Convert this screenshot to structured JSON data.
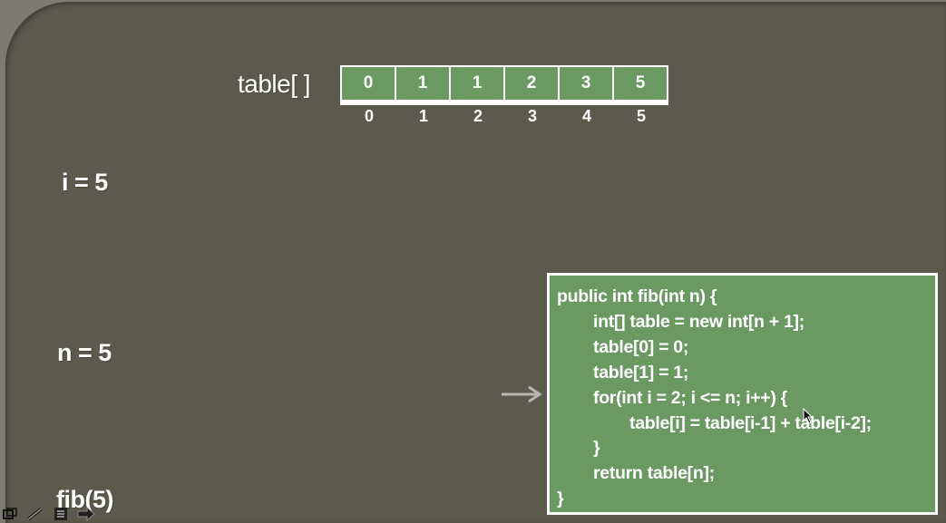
{
  "slide": {
    "table_label": "table[ ]",
    "array_values": [
      "0",
      "1",
      "1",
      "2",
      "3",
      "5"
    ],
    "array_indices": [
      "0",
      "1",
      "2",
      "3",
      "4",
      "5"
    ],
    "i_label": "i = 5",
    "n_label": "n = 5",
    "call_label": "fib(5)"
  },
  "code": {
    "lines": [
      "public int fib(int n) {",
      "int[] table = new int[n + 1];",
      "table[0] = 0;",
      "table[1] = 1;",
      "for(int i = 2; i <= n; i++) {",
      "table[i] = table[i-1] + table[i-2];",
      "}",
      "return table[n];",
      "}"
    ]
  },
  "colors": {
    "background": "#5b5a4c",
    "cell_fill": "#6a9a62",
    "text": "#ffffff"
  },
  "icons": {
    "pointer": "arrow-right-icon",
    "cursor": "mouse-cursor-icon",
    "toolbar": [
      "slide-nav-icon",
      "pen-icon",
      "notes-icon",
      "next-arrow-icon"
    ]
  }
}
